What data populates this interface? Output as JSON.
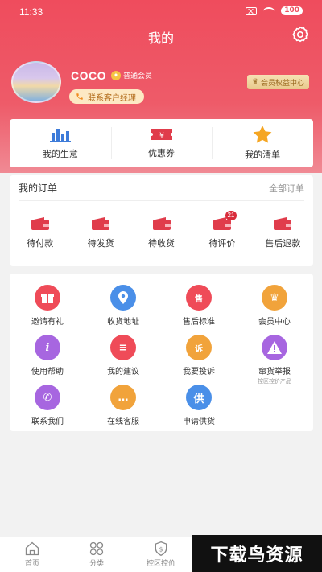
{
  "status": {
    "time": "11:33",
    "battery": "100"
  },
  "header": {
    "title": "我的"
  },
  "profile": {
    "username": "COCO",
    "member_level": "普通会员",
    "contact_manager": "联系客户经理",
    "rights_center": "会员权益中心"
  },
  "quick": [
    {
      "label": "我的生意",
      "icon": "bar-chart-icon",
      "color": "#3d7bd9"
    },
    {
      "label": "优惠券",
      "icon": "coupon-icon",
      "color": "#e03c4b"
    },
    {
      "label": "我的清单",
      "icon": "star-icon",
      "color": "#f5a623"
    }
  ],
  "orders": {
    "title": "我的订单",
    "all": "全部订单",
    "items": [
      {
        "label": "待付款",
        "badge": ""
      },
      {
        "label": "待发货",
        "badge": ""
      },
      {
        "label": "待收货",
        "badge": ""
      },
      {
        "label": "待评价",
        "badge": "21"
      },
      {
        "label": "售后退款",
        "badge": ""
      }
    ],
    "icon_color": "#e03c4b"
  },
  "services": [
    {
      "label": "邀请有礼",
      "glyph": "🎁",
      "color": "#ef4b58",
      "icon": "gift-icon",
      "sub": ""
    },
    {
      "label": "收货地址",
      "glyph": "●",
      "color": "#4a8fe8",
      "icon": "location-icon",
      "sub": ""
    },
    {
      "label": "售后标准",
      "glyph": "售",
      "color": "#ef4b58",
      "icon": "after-sale-icon",
      "sub": ""
    },
    {
      "label": "会员中心",
      "glyph": "♛",
      "color": "#f1a33b",
      "icon": "crown-icon",
      "sub": ""
    },
    {
      "label": "使用帮助",
      "glyph": "i",
      "color": "#a766e0",
      "icon": "help-icon",
      "sub": ""
    },
    {
      "label": "我的建议",
      "glyph": "≡",
      "color": "#ef4b58",
      "icon": "suggestion-icon",
      "sub": ""
    },
    {
      "label": "我要投诉",
      "glyph": "诉",
      "color": "#f1a33b",
      "icon": "complaint-icon",
      "sub": ""
    },
    {
      "label": "窜货举报",
      "glyph": "!",
      "color": "#a766e0",
      "icon": "warning-icon",
      "sub": "控区控价产品"
    },
    {
      "label": "联系我们",
      "glyph": "✆",
      "color": "#a766e0",
      "icon": "phone-icon",
      "sub": ""
    },
    {
      "label": "在线客服",
      "glyph": "…",
      "color": "#f1a33b",
      "icon": "chat-icon",
      "sub": ""
    },
    {
      "label": "申请供货",
      "glyph": "供",
      "color": "#4a8fe8",
      "icon": "supply-icon",
      "sub": ""
    }
  ],
  "tabs": [
    {
      "label": "首页",
      "icon": "home-icon"
    },
    {
      "label": "分类",
      "icon": "grid-icon"
    },
    {
      "label": "控区控价",
      "icon": "price-shield-icon"
    }
  ],
  "watermark": "下载鸟资源"
}
